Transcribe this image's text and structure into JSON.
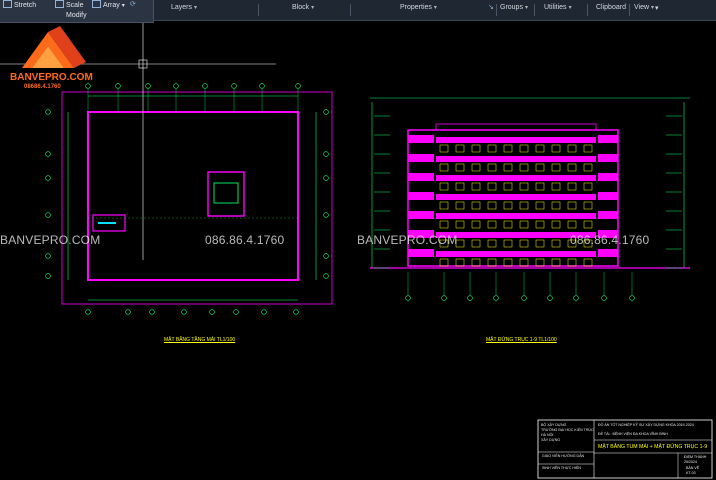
{
  "ribbon": {
    "modify_tools": [
      {
        "label": "Stretch",
        "icon": "stretch-icon"
      },
      {
        "label": "Scale",
        "icon": "scale-icon"
      },
      {
        "label": "Array",
        "icon": "array-icon"
      }
    ],
    "modify_panel_title": "Modify",
    "panels": [
      "Layers",
      "Block",
      "Properties",
      "Groups",
      "Utilities",
      "Clipboard",
      "View"
    ]
  },
  "logo": {
    "brand": "BANVEPRO.COM",
    "phone": "08686.4.1760"
  },
  "watermark": {
    "brand_left": "BANVEPRO.COM",
    "phone_left": "086.86.4.1760",
    "brand_right": "BANVEPRO.COM",
    "phone_right": "086.86.4.1760"
  },
  "sheets": {
    "plan_title": "MẶT BẰNG TẦNG MÁI TL1/100",
    "elevation_title": "MẶT ĐỨNG TRỤC 1-9 TL1/100"
  },
  "title_block": {
    "ministry": "BỘ XÂY DỰNG",
    "school": "TRƯỜNG ĐẠI HỌC KIẾN TRÚC",
    "city": "HÀ NỘI",
    "faculty": "XÂY DỰNG",
    "project_header": "ĐỒ ÁN TỐT NGHIỆP KỸ SƯ XÂY DỰNG KHÓA 2019-2024",
    "topic": "ĐỀ TÀI : BỆNH VIỆN ĐA KHOA VĨNH BÌNH",
    "supervisor": "GIÁO VIÊN HƯỚNG DẪN",
    "student": "SINH VIÊN THỰC HIỆN",
    "sheet_name": "MẶT BẰNG TUM MÁI + MẶT ĐỨNG TRỤC 1-9",
    "class_label": "ĐIỂM THÀNH",
    "class_value": "25/2024",
    "drawing_label": "BẢN VẼ",
    "drawing_no": "KT-03"
  },
  "colors": {
    "ribbon_bg": "#1f2733",
    "canvas_bg": "#000000",
    "magenta": "#ff00ff",
    "yellow": "#ffff00",
    "green": "#00ff66",
    "cyan": "#00e5ff",
    "brand_orange": "#ff6a1a"
  }
}
